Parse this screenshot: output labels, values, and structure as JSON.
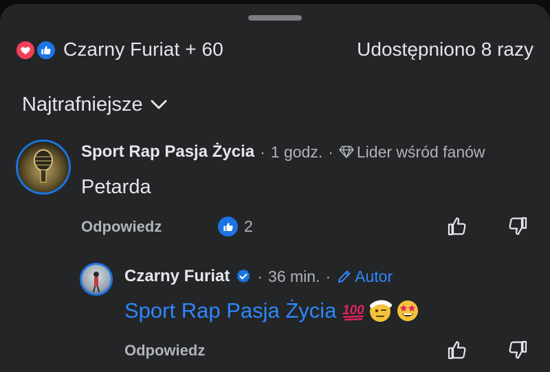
{
  "header": {
    "reactions_label": "Czarny Furiat + 60",
    "shares_label": "Udostępniono 8 razy"
  },
  "sort": {
    "label": "Najtrafniejsze"
  },
  "comments": [
    {
      "author": "Sport Rap Pasja Życia",
      "time": "1 godz.",
      "badge": "Lider wśród fanów",
      "text": "Petarda",
      "reply_label": "Odpowiedz",
      "like_count": "2"
    },
    {
      "author": "Czarny Furiat",
      "time": "36 min.",
      "badge": "Autor",
      "text": "Sport Rap Pasja Życia",
      "reply_label": "Odpowiedz"
    }
  ],
  "colors": {
    "sheet_bg": "#242526",
    "accent_blue": "#1b74e4",
    "link_blue": "#2d88ff",
    "heart_red": "#f33e58",
    "muted_text": "#b0b3b8"
  },
  "icons": [
    "heart-reaction-icon",
    "like-reaction-icon",
    "chevron-down-icon",
    "diamond-icon",
    "pencil-icon",
    "verified-icon",
    "thumb-up-icon",
    "thumb-down-icon",
    "hundred-points-emoji",
    "face-with-bandage-emoji",
    "star-struck-emoji"
  ]
}
